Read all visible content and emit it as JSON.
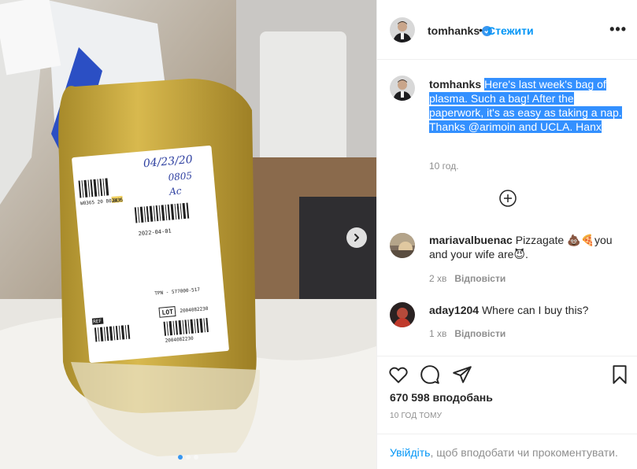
{
  "post": {
    "username": "tomhanks",
    "follow_label": "Стежити",
    "separator": "•",
    "more_label": "•••",
    "caption": {
      "username": "tomhanks",
      "text": "Here's last week's bag of plasma. Such a bag!  After the paperwork, it's as easy as taking a nap.  Thanks @arimoin and UCLA. Hanx",
      "time": "10 год."
    },
    "comments": [
      {
        "username": "mariavalbuenac",
        "text": "Pizzagate 💩🍕you and your wife are😈.",
        "time": "2 хв",
        "reply_label": "Відповісти"
      },
      {
        "username": "aday1204",
        "text": "Where can I buy this?",
        "time": "1 хв",
        "reply_label": "Відповісти"
      }
    ],
    "likes": "670 598 вподобань",
    "posted_ago": "10 ГОД ТОМУ",
    "login_prompt": {
      "link": "Увійдіть",
      "rest": ", щоб вподобати чи прокоментувати."
    }
  },
  "photo": {
    "label_date": "04/23/20",
    "label_time": "0805",
    "label_initials": "Ac",
    "expiry": "2022-04-01",
    "tpn": "TPN - 577000-517",
    "lot_label": "LOT",
    "lot_number": "2004082230",
    "ref_label": "REF",
    "barcode_number": "2004082230",
    "top_code": "W0365 20 802435",
    "top_code_suffix": "BLY",
    "carousel_slides": 3,
    "active_slide": 1
  },
  "colors": {
    "accent": "#0095f6",
    "selection": "#3390ff",
    "muted": "#8e8e8e"
  },
  "icons": [
    "verified-badge-icon",
    "more-options-icon",
    "load-more-icon",
    "heart-icon",
    "comment-icon",
    "share-icon",
    "bookmark-icon",
    "carousel-next-icon"
  ]
}
